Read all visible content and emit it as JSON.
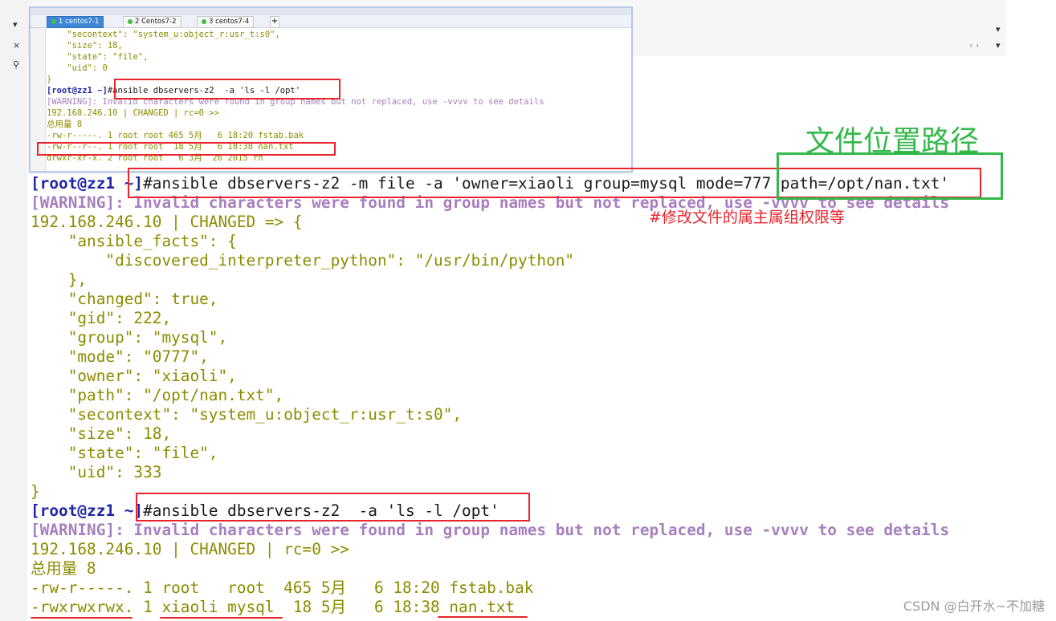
{
  "frame": {
    "close_glyph": "×",
    "search_glyph": "⚲",
    "dropdown_glyph": "▾",
    "nav_glyph": "‹ ›"
  },
  "mini_window": {
    "tabs": [
      {
        "label": "1 centos7-1",
        "close": "×",
        "active": true
      },
      {
        "label": "2 Centos7-2",
        "close": "×",
        "active": false
      },
      {
        "label": "3 centos7-4",
        "close": "×",
        "active": false
      }
    ],
    "add_tab": "+",
    "lines": [
      "    \"secontext\": \"system_u:object_r:usr_t:s0\",",
      "    \"size\": 18,",
      "    \"state\": \"file\",",
      "    \"uid\": 0",
      "}",
      {
        "prompt": "[root@zz1 ~]",
        "cmd": "#ansible dbservers-z2  -a 'ls -l /opt'"
      },
      "[WARNING]: Invalid characters were found in group names but not replaced, use -vvvv to see details",
      "192.168.246.10 | CHANGED | rc=0 >>",
      "总用量 8",
      "-rw-r-----. 1 root root 465 5月   6 18:20 fstab.bak",
      "-rw-r--r--. 1 root root  18 5月   6 18:38 nan.txt",
      "drwxr-xr-x. 2 root root   6 3月  26 2015 rh"
    ]
  },
  "terminal": {
    "cmd1": {
      "prompt": "[root@zz1 ~]",
      "cmd": "#ansible dbservers-z2 -m file -a 'owner=xiaoli group=mysql mode=777 path=/opt/nan.txt'"
    },
    "warning": "[WARNING]: Invalid characters were found in group names but not replaced, use -vvvv to see details",
    "changed_json": "192.168.246.10 | CHANGED => {",
    "output_lines": [
      "    \"ansible_facts\": {",
      "        \"discovered_interpreter_python\": \"/usr/bin/python\"",
      "    },",
      "    \"changed\": true,",
      "    \"gid\": 222,",
      "    \"group\": \"mysql\",",
      "    \"mode\": \"0777\",",
      "    \"owner\": \"xiaoli\",",
      "    \"path\": \"/opt/nan.txt\",",
      "    \"secontext\": \"system_u:object_r:usr_t:s0\",",
      "    \"size\": 18,",
      "    \"state\": \"file\",",
      "    \"uid\": 333",
      "}"
    ],
    "cmd2": {
      "prompt": "[root@zz1 ~]",
      "cmd": "#ansible dbservers-z2  -a 'ls -l /opt'"
    },
    "warning2": "[WARNING]: Invalid characters were found in group names but not replaced, use -vvvv to see details",
    "changed_rc": "192.168.246.10 | CHANGED | rc=0 >>",
    "total": "总用量 8",
    "ls_lines": [
      "-rw-r-----. 1 root   root  465 5月   6 18:20 fstab.bak",
      "-rwxrwxrwx. 1 xiaoli mysql  18 5月   6 18:38 nan.txt"
    ]
  },
  "annotations": {
    "green_label": "文件位置路径",
    "red_label": "#修改文件的属主属组权限等"
  },
  "watermark": "CSDN @白开水~不加糖",
  "colors": {
    "prompt": "#1f27a8",
    "output": "#8c8c00",
    "warning": "#a77fbe",
    "annotation_red": "#e8242c",
    "annotation_green": "#33b94a",
    "active_tab": "#3f86d6"
  }
}
